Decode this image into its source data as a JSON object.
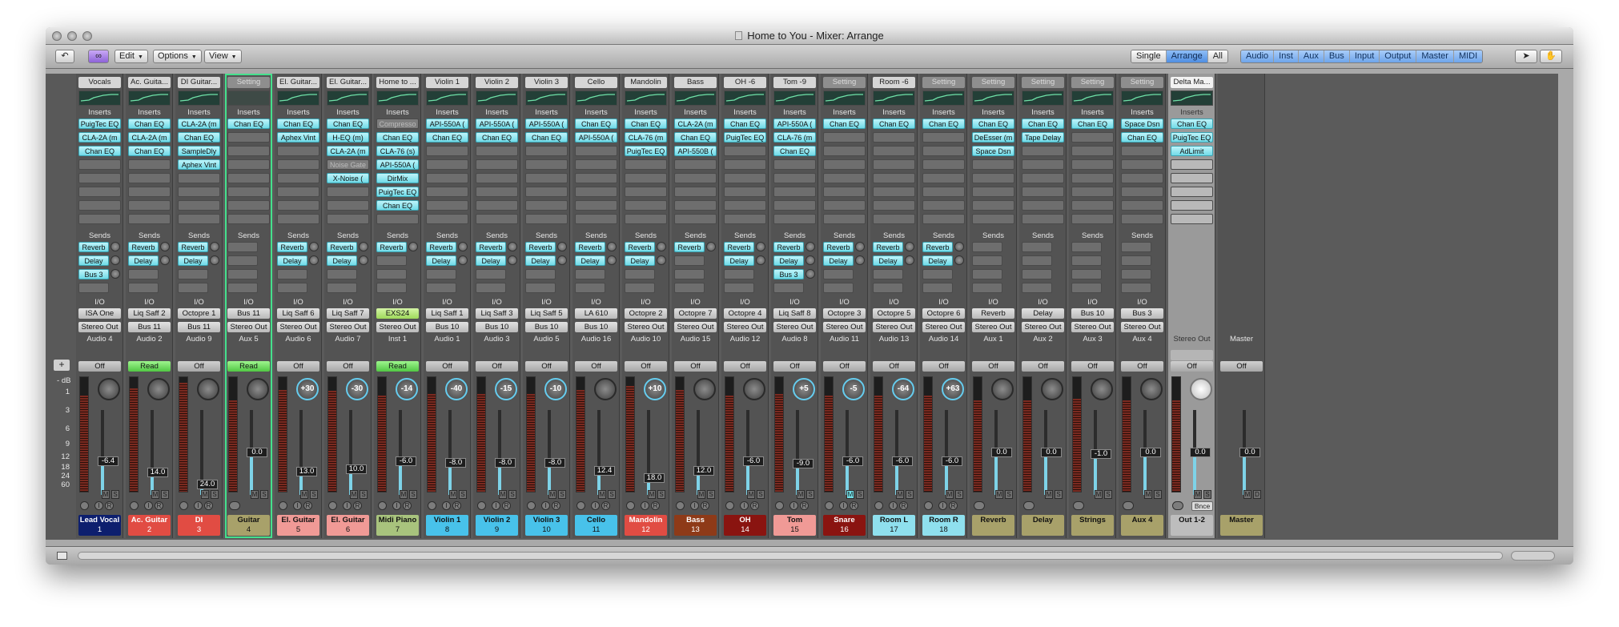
{
  "window": {
    "title": "Home to You - Mixer: Arrange"
  },
  "toolbar": {
    "edit": "Edit",
    "options": "Options",
    "view": "View",
    "view_modes": [
      "Single",
      "Arrange",
      "All"
    ],
    "active_view_mode": "Arrange",
    "filters": [
      "Audio",
      "Inst",
      "Aux",
      "Bus",
      "Input",
      "Output",
      "Master",
      "MIDI"
    ]
  },
  "labels": {
    "inserts": "Inserts",
    "sends": "Sends",
    "io": "I/O",
    "add": "+",
    "db": "dB",
    "mute": "M",
    "solo": "S",
    "input": "I",
    "record": "R",
    "bounce": "Bnce",
    "dim": "D"
  },
  "scale": [
    "1",
    "3",
    "6",
    "9",
    "12",
    "18",
    "24",
    "60"
  ],
  "strips": [
    {
      "name": "Vocals",
      "eq": "curve",
      "inserts": [
        "PuigTec EQ",
        "CLA-2A (m",
        "Chan EQ"
      ],
      "sends": [
        [
          "Reverb",
          1
        ],
        [
          "Delay",
          1
        ],
        [
          "Bus 3",
          1
        ]
      ],
      "in": "ISA One",
      "out": "Stereo Out",
      "track": "Audio 4",
      "auto": "Off",
      "pan": "",
      "vol": "-6.4",
      "level": 0.4,
      "label": "Lead Vocal",
      "num": "1",
      "color": "#0d1f6e",
      "fg": "#ffffff"
    },
    {
      "name": "Ac. Guita...",
      "eq": "curve",
      "inserts": [
        "Chan EQ",
        "CLA-2A (m",
        "Chan EQ"
      ],
      "sends": [
        [
          "Reverb",
          1
        ],
        [
          "Delay",
          1
        ]
      ],
      "in": "Liq Saff 2",
      "out": "Bus 11",
      "track": "Audio 2",
      "auto": "Read",
      "pan": "",
      "vol": "14.0",
      "level": 0.26,
      "label": "Ac. Guitar",
      "num": "2",
      "color": "#e14c43",
      "fg": "#ffffff"
    },
    {
      "name": "DI Guitar...",
      "eq": "curve",
      "inserts": [
        "CLA-2A (m",
        "Chan EQ",
        "SampleDly",
        "Aphex Vint"
      ],
      "sends": [
        [
          "Reverb",
          1
        ],
        [
          "Delay",
          1
        ]
      ],
      "in": "Octopre 1",
      "out": "Bus 11",
      "track": "Audio 9",
      "auto": "Off",
      "pan": "",
      "vol": "24.0",
      "level": 0.12,
      "label": "DI",
      "num": "3",
      "color": "#e14c43",
      "fg": "#ffffff"
    },
    {
      "name": "Setting",
      "eq": "none",
      "inserts": [
        "Chan EQ"
      ],
      "sends": [],
      "in": "Bus 11",
      "out": "Stereo Out",
      "track": "Aux 5",
      "auto": "Read",
      "pan": "",
      "vol": "0.0",
      "level": 0.5,
      "label": "Guitar",
      "num": "4",
      "color": "#a8a16a",
      "fg": "#111111",
      "sel": true
    },
    {
      "name": "El. Guitar...",
      "eq": "curve",
      "inserts": [
        "Chan EQ",
        "Aphex Vint"
      ],
      "sends": [
        [
          "Reverb",
          1
        ],
        [
          "Delay",
          1
        ]
      ],
      "in": "Liq Saff 6",
      "out": "Stereo Out",
      "track": "Audio 6",
      "auto": "Off",
      "pan": "+30",
      "vol": "13.0",
      "level": 0.27,
      "label": "El. Guitar",
      "num": "5",
      "color": "#f09a96",
      "fg": "#111111"
    },
    {
      "name": "El. Guitar...",
      "eq": "curve",
      "inserts": [
        "Chan EQ",
        "H-EQ (m)",
        "CLA-2A (m",
        "Noise Gate",
        "X-Noise ("
      ],
      "sends": [
        [
          "Reverb",
          1
        ],
        [
          "Delay",
          1
        ]
      ],
      "in": "Liq Saff 7",
      "out": "Stereo Out",
      "track": "Audio 7",
      "auto": "Off",
      "pan": "-30",
      "vol": "10.0",
      "level": 0.3,
      "label": "El. Guitar",
      "num": "6",
      "color": "#f09a96",
      "fg": "#111111"
    },
    {
      "name": "Home to ...",
      "eq": "curve",
      "inserts": [
        "Compresso",
        "Chan EQ",
        "CLA-76 (s)",
        "API-550A (",
        "DirMix",
        "PuigTec EQ",
        "Chan EQ"
      ],
      "sends": [
        [
          "Reverb",
          1
        ]
      ],
      "in": "EXS24",
      "out": "Stereo Out",
      "track": "Inst 1",
      "auto": "Read",
      "pan": "-14",
      "vol": "-6.0",
      "level": 0.4,
      "label": "Midi Piano",
      "num": "7",
      "color": "#a8c37d",
      "fg": "#111111"
    },
    {
      "name": "Violin 1",
      "eq": "curve",
      "inserts": [
        "API-550A (",
        "Chan EQ"
      ],
      "sends": [
        [
          "Reverb",
          1
        ],
        [
          "Delay",
          1
        ]
      ],
      "in": "Liq Saff 1",
      "out": "Bus 10",
      "track": "Audio 1",
      "auto": "Off",
      "pan": "-40",
      "vol": "-8.0",
      "level": 0.38,
      "label": "Violin 1",
      "num": "8",
      "color": "#48c2ea",
      "fg": "#111111"
    },
    {
      "name": "Violin 2",
      "eq": "curve",
      "inserts": [
        "API-550A (",
        "Chan EQ"
      ],
      "sends": [
        [
          "Reverb",
          1
        ],
        [
          "Delay",
          1
        ]
      ],
      "in": "Liq Saff 3",
      "out": "Bus 10",
      "track": "Audio 3",
      "auto": "Off",
      "pan": "-15",
      "vol": "-8.0",
      "level": 0.38,
      "label": "Violin 2",
      "num": "9",
      "color": "#48c2ea",
      "fg": "#111111"
    },
    {
      "name": "Violin 3",
      "eq": "curve",
      "inserts": [
        "API-550A (",
        "Chan EQ"
      ],
      "sends": [
        [
          "Reverb",
          1
        ],
        [
          "Delay",
          1
        ]
      ],
      "in": "Liq Saff 5",
      "out": "Bus 10",
      "track": "Audio 5",
      "auto": "Off",
      "pan": "-10",
      "vol": "-8.0",
      "level": 0.38,
      "label": "Violin 3",
      "num": "10",
      "color": "#48c2ea",
      "fg": "#111111"
    },
    {
      "name": "Cello",
      "eq": "curve",
      "inserts": [
        "Chan EQ",
        "API-550A ("
      ],
      "sends": [
        [
          "Reverb",
          1
        ],
        [
          "Delay",
          1
        ]
      ],
      "in": "LA 610",
      "out": "Bus 10",
      "track": "Audio 16",
      "auto": "Off",
      "pan": "",
      "vol": "12.4",
      "level": 0.28,
      "label": "Cello",
      "num": "11",
      "color": "#48c2ea",
      "fg": "#111111"
    },
    {
      "name": "Mandolin",
      "eq": "curve",
      "inserts": [
        "Chan EQ",
        "CLA-76 (m",
        "PuigTec EQ"
      ],
      "sends": [
        [
          "Reverb",
          1
        ],
        [
          "Delay",
          1
        ]
      ],
      "in": "Octopre 2",
      "out": "Stereo Out",
      "track": "Audio 10",
      "auto": "Off",
      "pan": "+10",
      "vol": "18.0",
      "level": 0.2,
      "label": "Mandolin",
      "num": "12",
      "color": "#e14c43",
      "fg": "#ffffff"
    },
    {
      "name": "Bass",
      "eq": "curve",
      "inserts": [
        "CLA-2A (m",
        "Chan EQ",
        "API-550B ("
      ],
      "sends": [
        [
          "Reverb",
          1
        ]
      ],
      "in": "Octopre 7",
      "out": "Stereo Out",
      "track": "Audio 15",
      "auto": "Off",
      "pan": "",
      "vol": "12.0",
      "level": 0.28,
      "label": "Bass",
      "num": "13",
      "color": "#8e3a18",
      "fg": "#ffffff"
    },
    {
      "name": "OH -6",
      "eq": "curve",
      "inserts": [
        "Chan EQ",
        "PuigTec EQ"
      ],
      "sends": [
        [
          "Reverb",
          1
        ],
        [
          "Delay",
          1
        ]
      ],
      "in": "Octopre 4",
      "out": "Stereo Out",
      "track": "Audio 12",
      "auto": "Off",
      "pan": "",
      "vol": "-6.0",
      "level": 0.4,
      "label": "OH",
      "num": "14",
      "color": "#8a1410",
      "fg": "#ffffff"
    },
    {
      "name": "Tom -9",
      "eq": "curve",
      "inserts": [
        "API-550A (",
        "CLA-76 (m",
        "Chan EQ"
      ],
      "sends": [
        [
          "Reverb",
          1
        ],
        [
          "Delay",
          1
        ],
        [
          "Bus 3",
          1
        ]
      ],
      "in": "Liq Saff 8",
      "out": "Stereo Out",
      "track": "Audio 8",
      "auto": "Off",
      "pan": "+5",
      "vol": "-9.0",
      "level": 0.37,
      "label": "Tom",
      "num": "15",
      "color": "#f09a96",
      "fg": "#111111"
    },
    {
      "name": "Setting",
      "eq": "curve",
      "inserts": [
        "Chan EQ"
      ],
      "sends": [
        [
          "Reverb",
          1
        ],
        [
          "Delay",
          1
        ]
      ],
      "in": "Octopre 3",
      "out": "Stereo Out",
      "track": "Audio 11",
      "auto": "Off",
      "pan": "-5",
      "vol": "-6.0",
      "level": 0.4,
      "label": "Snare",
      "num": "16",
      "color": "#8a1410",
      "fg": "#ffffff",
      "mute": true
    },
    {
      "name": "Room -6",
      "eq": "curve",
      "inserts": [
        "Chan EQ"
      ],
      "sends": [
        [
          "Reverb",
          1
        ],
        [
          "Delay",
          1
        ]
      ],
      "in": "Octopre 5",
      "out": "Stereo Out",
      "track": "Audio 13",
      "auto": "Off",
      "pan": "-64",
      "vol": "-6.0",
      "level": 0.4,
      "label": "Room L",
      "num": "17",
      "color": "#8fe0ee",
      "fg": "#111111"
    },
    {
      "name": "Setting",
      "eq": "curve",
      "inserts": [
        "Chan EQ"
      ],
      "sends": [
        [
          "Reverb",
          1
        ],
        [
          "Delay",
          1
        ]
      ],
      "in": "Octopre 6",
      "out": "Stereo Out",
      "track": "Audio 14",
      "auto": "Off",
      "pan": "+63",
      "vol": "-6.0",
      "level": 0.4,
      "label": "Room R",
      "num": "18",
      "color": "#8fe0ee",
      "fg": "#111111"
    },
    {
      "name": "Setting",
      "eq": "curve",
      "inserts": [
        "Chan EQ",
        "DeEsser (m",
        "Space Dsn"
      ],
      "sends": [],
      "in": "Reverb",
      "out": "Stereo Out",
      "track": "Aux 1",
      "auto": "Off",
      "pan": "",
      "vol": "0.0",
      "level": 0.5,
      "label": "Reverb",
      "num": "",
      "color": "#a8a16a",
      "fg": "#111111"
    },
    {
      "name": "Setting",
      "eq": "curve",
      "inserts": [
        "Chan EQ",
        "Tape Delay"
      ],
      "sends": [],
      "in": "Delay",
      "out": "Stereo Out",
      "track": "Aux 2",
      "auto": "Off",
      "pan": "",
      "vol": "0.0",
      "level": 0.5,
      "label": "Delay",
      "num": "",
      "color": "#a8a16a",
      "fg": "#111111"
    },
    {
      "name": "Setting",
      "eq": "curve",
      "inserts": [
        "Chan EQ"
      ],
      "sends": [],
      "in": "Bus 10",
      "out": "Stereo Out",
      "track": "Aux 3",
      "auto": "Off",
      "pan": "",
      "vol": "-1.0",
      "level": 0.48,
      "label": "Strings",
      "num": "",
      "color": "#a8a16a",
      "fg": "#111111"
    },
    {
      "name": "Setting",
      "eq": "curve",
      "inserts": [
        "Space Dsn",
        "Chan EQ"
      ],
      "sends": [],
      "in": "Bus 3",
      "out": "Stereo Out",
      "track": "Aux 4",
      "auto": "Off",
      "pan": "",
      "vol": "0.0",
      "level": 0.5,
      "label": "Aux 4",
      "num": "",
      "color": "#a8a16a",
      "fg": "#111111"
    },
    {
      "name": "Delta Ma...",
      "eq": "curve",
      "inserts": [
        "Chan EQ",
        "PuigTec EQ",
        "AdLimit"
      ],
      "sends": [],
      "in": "",
      "out": "",
      "track": "Stereo Out",
      "auto": "Off",
      "pan": "",
      "vol": "0.0",
      "level": 0.5,
      "label": "Out 1-2",
      "num": "",
      "color": "#bdbdbd",
      "fg": "#111111",
      "outstrip": true
    },
    {
      "name": "",
      "eq": "none",
      "inserts": [],
      "sends": [],
      "in": "",
      "out": "",
      "track": "Master",
      "auto": "Off",
      "pan": "",
      "vol": "0.0",
      "level": 0.5,
      "label": "Master",
      "num": "",
      "color": "#a8a16a",
      "fg": "#111111",
      "master": true
    }
  ]
}
